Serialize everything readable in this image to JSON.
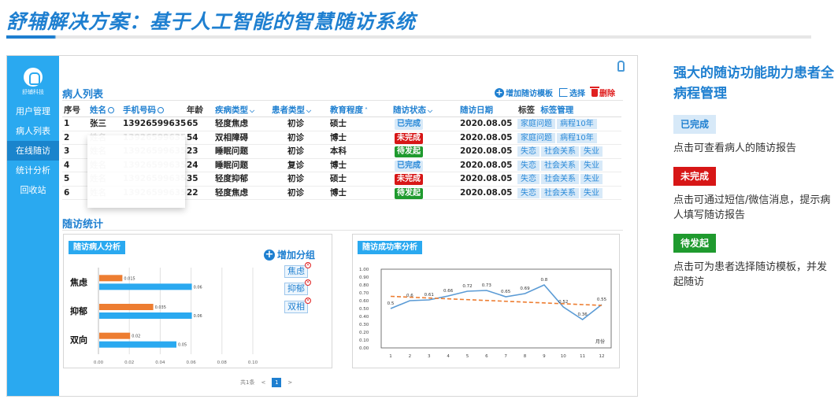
{
  "header": {
    "title": "舒辅解决方案：基于人工智能的智慧随访系统"
  },
  "sidebar": {
    "logo_text": "舒辅科技",
    "items": [
      {
        "label": "用户管理"
      },
      {
        "label": "病人列表"
      },
      {
        "label": "在线随访"
      },
      {
        "label": "统计分析"
      },
      {
        "label": "回收站"
      }
    ]
  },
  "patients": {
    "title": "病人列表",
    "toolbar": {
      "add_template": "增加随访模板",
      "select": "选择",
      "delete": "删除"
    },
    "columns": [
      "序号",
      "姓名",
      "手机号码",
      "年龄",
      "疾病类型",
      "患者类型",
      "教育程度",
      "随访状态",
      "随访日期",
      "标签",
      "标签管理"
    ],
    "rows": [
      {
        "no": "1",
        "name": "张三",
        "phone": "13926599635",
        "age": "65",
        "disease": "轻度焦虑",
        "ptype": "初诊",
        "edu": "硕士",
        "status": "已完成",
        "date": "2020.08.05",
        "tags": [
          "家庭问题",
          "病程10年"
        ]
      },
      {
        "no": "2",
        "name": "姓名",
        "phone": "13926599635",
        "age": "54",
        "disease": "双相障碍",
        "ptype": "初诊",
        "edu": "博士",
        "status": "未完成",
        "date": "2020.08.05",
        "tags": [
          "家庭问题",
          "病程10年"
        ]
      },
      {
        "no": "3",
        "name": "姓名",
        "phone": "13926599635",
        "age": "23",
        "disease": "睡眠问题",
        "ptype": "初诊",
        "edu": "本科",
        "status": "待发起",
        "date": "2020.08.05",
        "tags": [
          "失恋",
          "社会关系",
          "失业"
        ]
      },
      {
        "no": "4",
        "name": "姓名",
        "phone": "13926599635",
        "age": "24",
        "disease": "睡眠问题",
        "ptype": "复诊",
        "edu": "博士",
        "status": "已完成",
        "date": "2020.08.05",
        "tags": [
          "失恋",
          "社会关系",
          "失业"
        ]
      },
      {
        "no": "5",
        "name": "姓名",
        "phone": "13926599635",
        "age": "35",
        "disease": "轻度抑郁",
        "ptype": "初诊",
        "edu": "硕士",
        "status": "未完成",
        "date": "2020.08.05",
        "tags": [
          "失恋",
          "社会关系",
          "失业"
        ]
      },
      {
        "no": "6",
        "name": "姓名",
        "phone": "13926599635",
        "age": "22",
        "disease": "轻度焦虑",
        "ptype": "初诊",
        "edu": "博士",
        "status": "待发起",
        "date": "2020.08.05",
        "tags": [
          "失恋",
          "社会关系",
          "失业"
        ]
      }
    ]
  },
  "stats": {
    "title": "随访统计",
    "add_group": "增加分组",
    "groups": [
      "焦虑",
      "抑郁",
      "双相"
    ]
  },
  "pager": {
    "total": "共1条",
    "page": "1"
  },
  "chart_data": [
    {
      "type": "bar",
      "title": "随访病人分析",
      "orientation": "horizontal",
      "categories": [
        "焦虑",
        "抑郁",
        "双向"
      ],
      "series": [
        {
          "values": [
            0.015,
            0.035,
            0.02
          ],
          "color": "#ed7d31"
        },
        {
          "values": [
            0.06,
            0.06,
            0.05
          ],
          "color": "#2aa9f0"
        }
      ],
      "xticks": [
        "0.00",
        "0.02",
        "0.04",
        "0.06",
        "0.08",
        "0.10"
      ],
      "xlim": [
        0,
        0.1
      ]
    },
    {
      "type": "line",
      "title": "随访成功率分析",
      "xlabel": "月份",
      "x": [
        1,
        2,
        3,
        4,
        5,
        6,
        7,
        8,
        9,
        10,
        11,
        12
      ],
      "values": [
        0.5,
        0.6,
        0.61,
        0.66,
        0.72,
        0.73,
        0.65,
        0.69,
        0.8,
        0.52,
        0.36,
        0.55
      ],
      "labels": [
        "0.5",
        "0.6",
        "0.61",
        "0.66",
        "0.72",
        "0.73",
        "0.65",
        "0.69",
        "0.8",
        "0.52",
        "0.36",
        "0.55"
      ],
      "trend": [
        0.655,
        0.54
      ],
      "yticks": [
        "0.00",
        "0.10",
        "0.20",
        "0.30",
        "0.40",
        "0.50",
        "0.60",
        "0.70",
        "0.80",
        "0.90",
        "1.00"
      ],
      "ylim": [
        0,
        1
      ],
      "line_color": "#5b9bd5",
      "trend_color": "#ed7d31"
    }
  ],
  "right_panel": {
    "title": "强大的随访功能助力患者全病程管理",
    "items": [
      {
        "badge": "已完成",
        "text": "点击可查看病人的随访报告"
      },
      {
        "badge": "未完成",
        "text": "点击可通过短信/微信消息，提示病人填写随访报告"
      },
      {
        "badge": "待发起",
        "text": "点击可为患者选择随访模板，并发起随访"
      }
    ]
  }
}
